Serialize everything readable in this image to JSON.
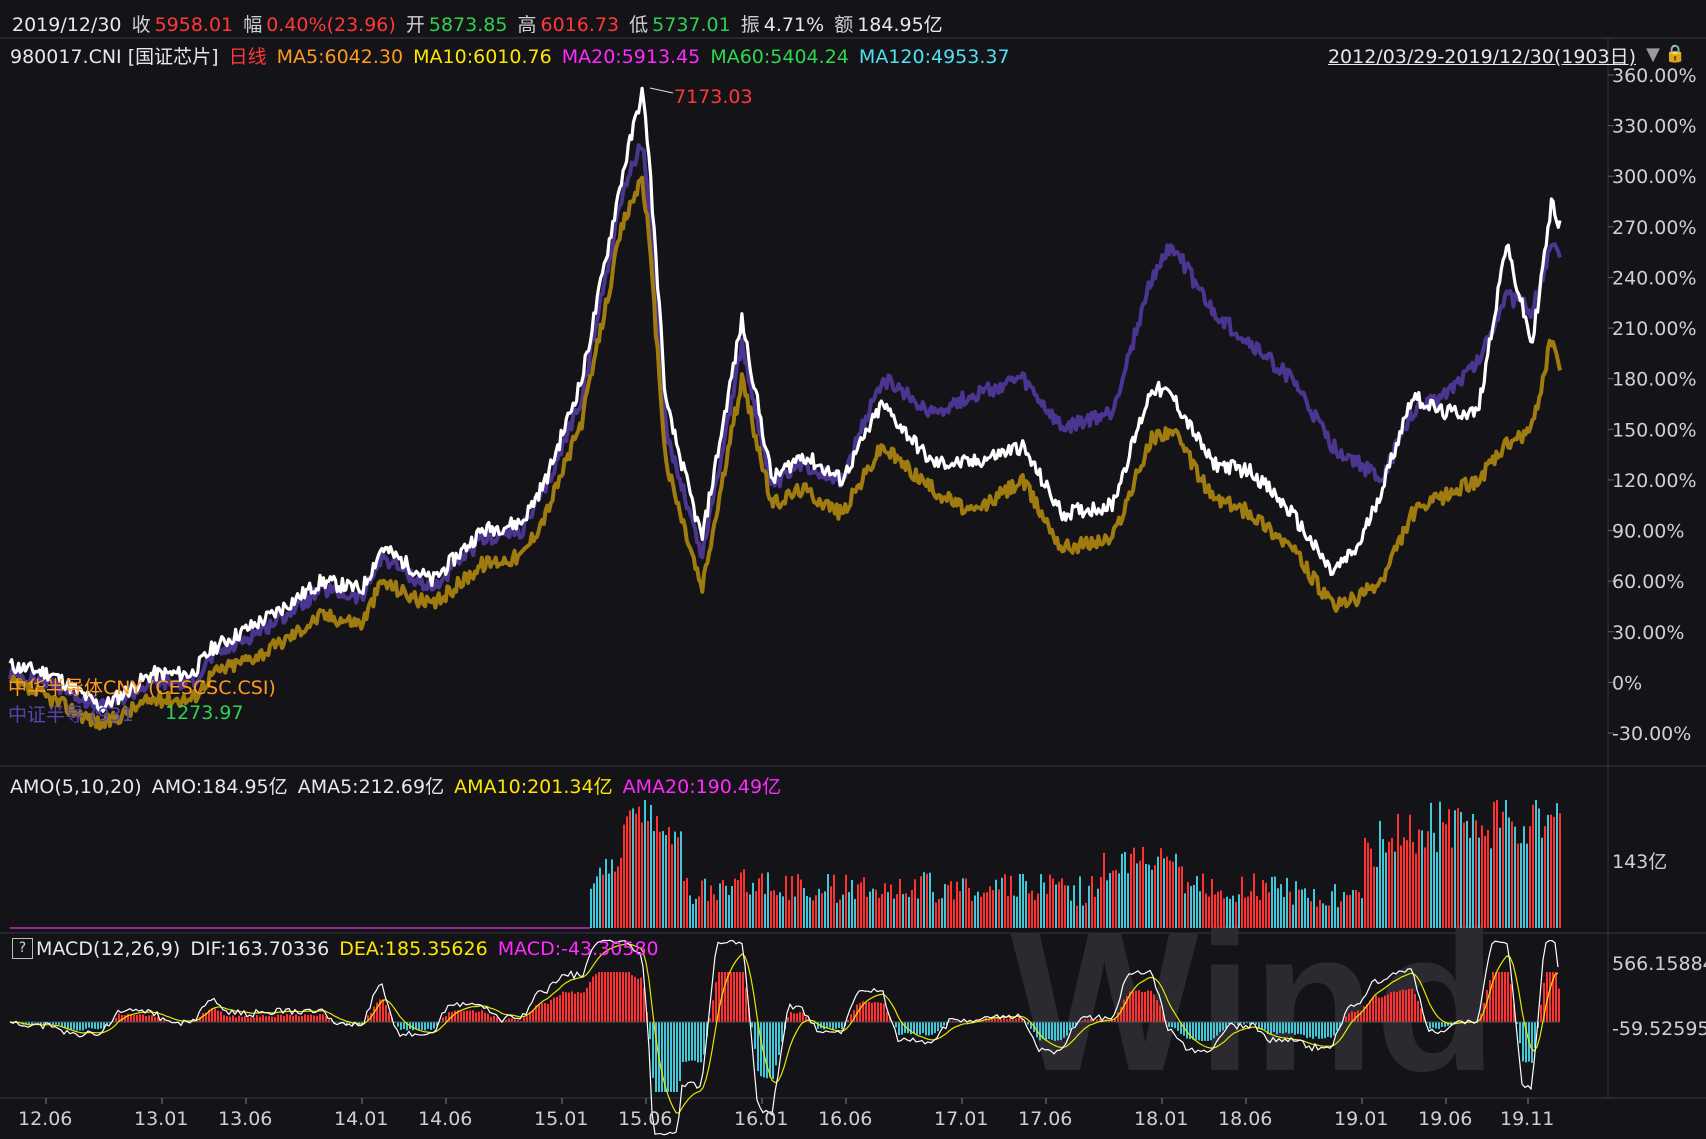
{
  "header": {
    "date": "2019/12/30",
    "close_label": "收",
    "close": "5958.01",
    "chg_label": "幅",
    "chg": "0.40%(23.96)",
    "open_label": "开",
    "open": "5873.85",
    "high_label": "高",
    "high": "6016.73",
    "low_label": "低",
    "low": "5737.01",
    "amp_label": "振",
    "amp": "4.71%",
    "amount_label": "额",
    "amount": "184.95亿"
  },
  "legend": {
    "code": "980017.CNI [国证芯片]",
    "period": "日线",
    "ma5": "MA5:6042.30",
    "ma10": "MA10:6010.76",
    "ma20": "MA20:5913.45",
    "ma60": "MA60:5404.24",
    "ma120": "MA120:4953.37",
    "range": "2012/03/29-2019/12/30(1903日)"
  },
  "compare": {
    "series1": "中华半导体CNY (CESCSC.CSI)",
    "series2": "中证半导 (931",
    "series2_tail": "1273.97"
  },
  "peak_label": "7173.03",
  "amo": {
    "title": "AMO(5,10,20)",
    "amo": "AMO:184.95亿",
    "ama5": "AMA5:212.69亿",
    "ama10": "AMA10:201.34亿",
    "ama20": "AMA20:190.49亿",
    "tick": "143亿"
  },
  "macd": {
    "help": "?",
    "title": "MACD(12,26,9)",
    "dif": "DIF:163.70336",
    "dea": "DEA:185.35626",
    "macd": "MACD:-43.30580",
    "tick_top": "566.15884",
    "tick_mid": "-59.52595"
  },
  "watermark": "Wind",
  "colors": {
    "background": "#131318",
    "main": "#ffffff",
    "purple": "#4b3590",
    "gold": "#a07c10",
    "red": "#ff3838",
    "cyan": "#40c8d8"
  },
  "chart_data": {
    "type": "line",
    "title": "",
    "yaxis_ticks": [
      "360.00%",
      "330.00%",
      "300.00%",
      "270.00%",
      "240.00%",
      "210.00%",
      "180.00%",
      "150.00%",
      "120.00%",
      "90.00%",
      "60.00%",
      "30.00%",
      "0%",
      "-30.00%"
    ],
    "ylim": [
      -30,
      360
    ],
    "xaxis_ticks": [
      "12.06",
      "13.01",
      "13.06",
      "14.01",
      "14.06",
      "15.01",
      "15.06",
      "16.01",
      "16.06",
      "17.01",
      "17.06",
      "18.01",
      "18.06",
      "19.01",
      "19.06",
      "19.11"
    ],
    "xlim": [
      2012.24,
      2019.99
    ],
    "series": [
      {
        "name": "980017.CNI [国证芯片]",
        "color": "#ffffff",
        "x": [
          2012.24,
          2012.45,
          2012.7,
          2012.95,
          2013.15,
          2013.25,
          2013.55,
          2013.8,
          2014.0,
          2014.1,
          2014.35,
          2014.6,
          2014.8,
          2014.92,
          2015.1,
          2015.3,
          2015.4,
          2015.43,
          2015.52,
          2015.7,
          2015.9,
          2016.05,
          2016.2,
          2016.4,
          2016.6,
          2016.85,
          2017.05,
          2017.3,
          2017.5,
          2017.75,
          2017.95,
          2018.05,
          2018.25,
          2018.45,
          2018.65,
          2018.85,
          2018.98,
          2019.1,
          2019.25,
          2019.4,
          2019.58,
          2019.72,
          2019.85,
          2019.95,
          2019.99
        ],
        "y": [
          10,
          5,
          -15,
          5,
          5,
          20,
          40,
          60,
          55,
          80,
          60,
          90,
          95,
          120,
          180,
          300,
          350,
          320,
          165,
          85,
          215,
          120,
          135,
          120,
          165,
          130,
          130,
          140,
          100,
          105,
          175,
          170,
          130,
          125,
          100,
          65,
          80,
          115,
          170,
          160,
          160,
          260,
          200,
          285,
          270
        ]
      },
      {
        "name": "中证半导 (931",
        "color": "#4b3590",
        "x": [
          2012.24,
          2012.45,
          2012.7,
          2012.95,
          2013.15,
          2013.25,
          2013.55,
          2013.8,
          2014.0,
          2014.1,
          2014.35,
          2014.6,
          2014.8,
          2014.92,
          2015.1,
          2015.3,
          2015.4,
          2015.43,
          2015.52,
          2015.7,
          2015.9,
          2016.05,
          2016.2,
          2016.4,
          2016.6,
          2016.85,
          2017.05,
          2017.3,
          2017.5,
          2017.75,
          2017.95,
          2018.05,
          2018.25,
          2018.45,
          2018.65,
          2018.85,
          2018.98,
          2019.1,
          2019.25,
          2019.4,
          2019.58,
          2019.72,
          2019.85,
          2019.95,
          2019.99
        ],
        "y": [
          5,
          0,
          -15,
          0,
          0,
          15,
          35,
          55,
          50,
          75,
          55,
          85,
          90,
          115,
          170,
          290,
          320,
          290,
          150,
          75,
          200,
          115,
          130,
          120,
          180,
          160,
          170,
          180,
          150,
          160,
          240,
          260,
          220,
          200,
          180,
          140,
          130,
          120,
          160,
          170,
          190,
          230,
          220,
          260,
          250
        ]
      },
      {
        "name": "中华半导体CNY (CESCSC.CSI)",
        "color": "#a07c10",
        "x": [
          2012.24,
          2012.45,
          2012.7,
          2012.95,
          2013.15,
          2013.25,
          2013.55,
          2013.8,
          2014.0,
          2014.1,
          2014.35,
          2014.6,
          2014.8,
          2014.92,
          2015.1,
          2015.3,
          2015.4,
          2015.43,
          2015.52,
          2015.7,
          2015.9,
          2016.05,
          2016.2,
          2016.4,
          2016.6,
          2016.85,
          2017.05,
          2017.3,
          2017.5,
          2017.75,
          2017.95,
          2018.05,
          2018.25,
          2018.45,
          2018.65,
          2018.85,
          2018.98,
          2019.1,
          2019.25,
          2019.4,
          2019.58,
          2019.72,
          2019.85,
          2019.95,
          2019.99
        ],
        "y": [
          0,
          -10,
          -25,
          -10,
          -10,
          5,
          20,
          40,
          35,
          60,
          45,
          70,
          75,
          100,
          155,
          270,
          300,
          270,
          130,
          55,
          180,
          105,
          115,
          100,
          140,
          115,
          100,
          120,
          80,
          85,
          145,
          150,
          110,
          100,
          80,
          45,
          50,
          60,
          100,
          110,
          120,
          140,
          150,
          205,
          185
        ]
      }
    ]
  }
}
